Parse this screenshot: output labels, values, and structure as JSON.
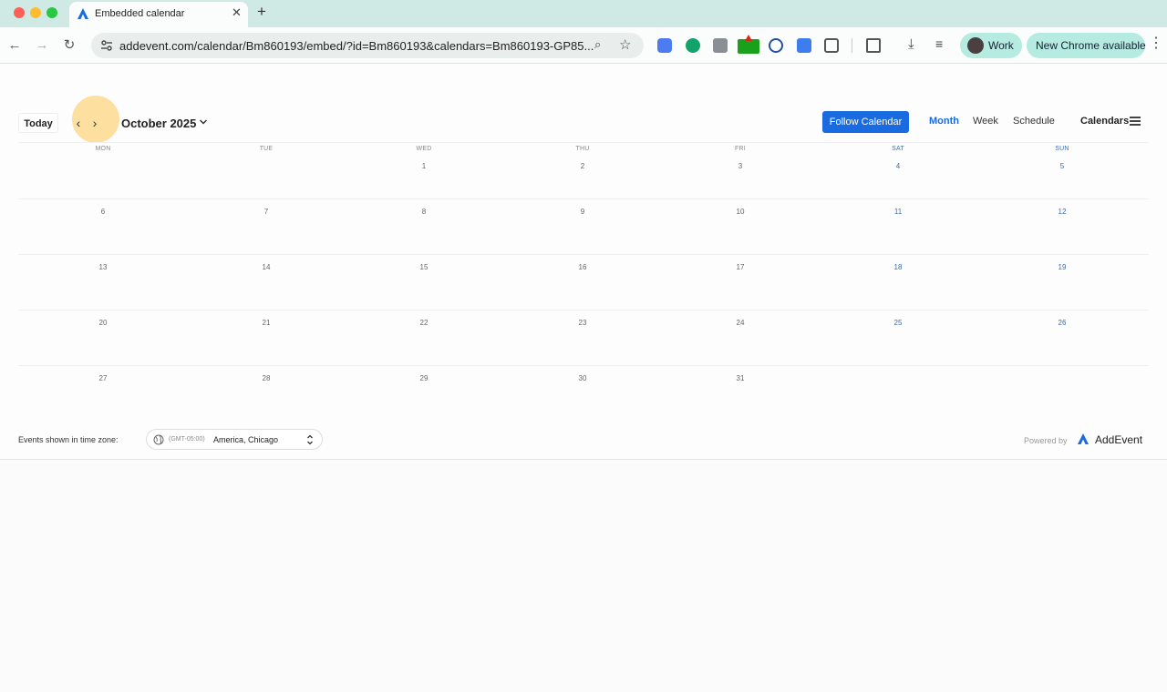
{
  "browser": {
    "tab": {
      "title": "Embedded calendar",
      "close": "✕"
    },
    "new_tab": "+",
    "url": "addevent.com/calendar/Bm860193/embed/?id=Bm860193&calendars=Bm860193-GP85...",
    "profile_name": "Work",
    "update_label": "New Chrome available",
    "icons": {
      "back": "←",
      "forward": "→",
      "reload": "↻",
      "zoom": "⌕",
      "star": "☆",
      "menu": "⋮",
      "download": "⤓",
      "media": "≡"
    }
  },
  "calendar": {
    "today_label": "Today",
    "prev": "‹",
    "next": "›",
    "month_title": "October 2025",
    "follow_label": "Follow Calendar",
    "views": [
      "Month",
      "Week",
      "Schedule"
    ],
    "active_view": "Month",
    "calendars_label": "Calendars",
    "weekdays": [
      "MON",
      "TUE",
      "WED",
      "THU",
      "FRI",
      "SAT",
      "SUN"
    ],
    "weeks": [
      [
        "",
        "",
        "1",
        "2",
        "3",
        "4",
        "5"
      ],
      [
        "6",
        "7",
        "8",
        "9",
        "10",
        "11",
        "12"
      ],
      [
        "13",
        "14",
        "15",
        "16",
        "17",
        "18",
        "19"
      ],
      [
        "20",
        "21",
        "22",
        "23",
        "24",
        "25",
        "26"
      ],
      [
        "27",
        "28",
        "29",
        "30",
        "31",
        "",
        ""
      ]
    ],
    "timezone_label": "Events shown in time zone:",
    "timezone_offset": "(GMT-05:00)",
    "timezone_city": "America, Chicago",
    "powered_by": "Powered by",
    "brand": "AddEvent",
    "colors": {
      "accent": "#1a6ae0",
      "weekend": "#3a6da8",
      "cursor_highlight": "#fcd378"
    }
  }
}
